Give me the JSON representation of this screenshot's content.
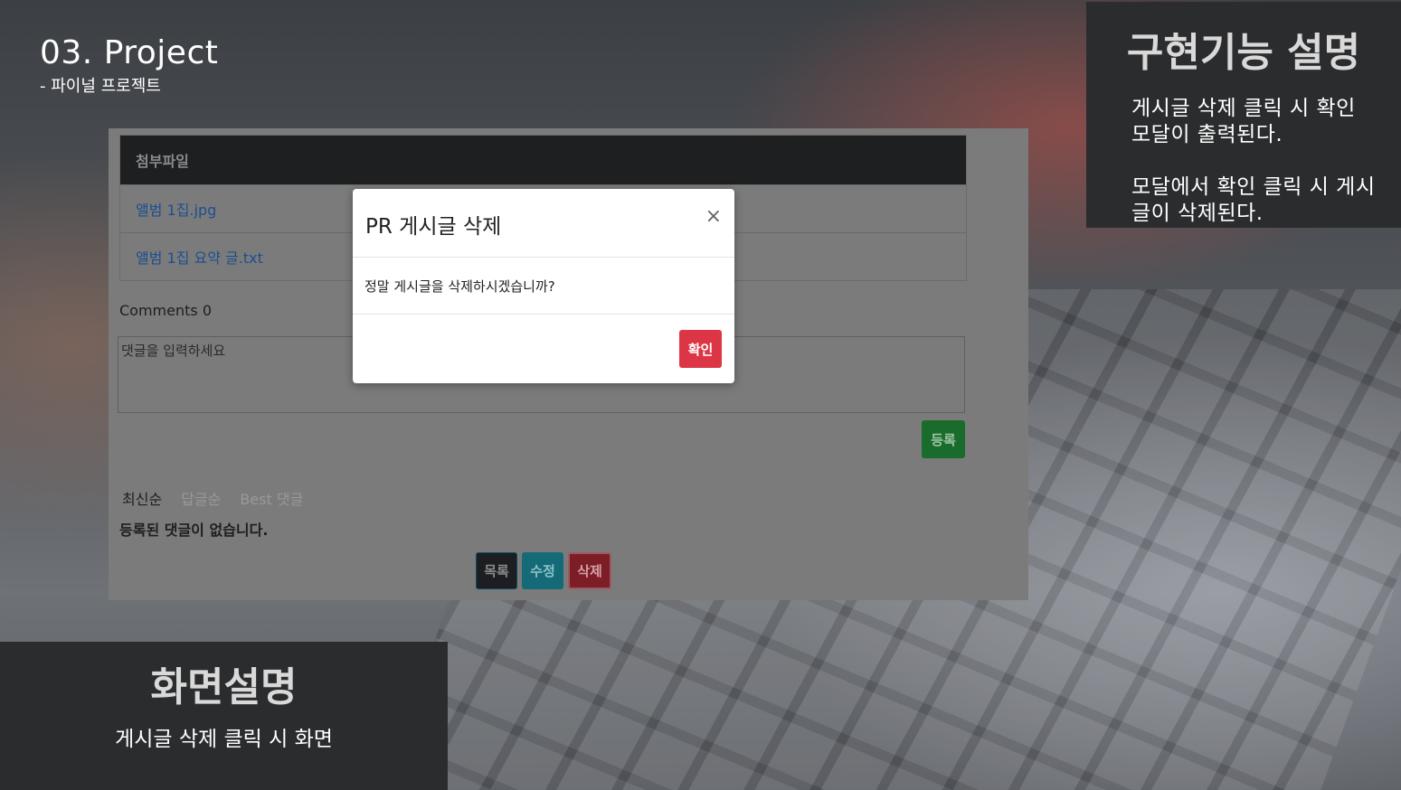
{
  "slide": {
    "title": "03.  Project",
    "subtitle": "- 파이널 프로젝트"
  },
  "feature_panel": {
    "heading": "구현기능 설명",
    "desc1": "게시글 삭제 클릭 시 확인 모달이 출력된다.",
    "desc2": "모달에서 확인 클릭 시 게시글이 삭제된다."
  },
  "screen_panel": {
    "heading": "화면설명",
    "desc": "게시글 삭제 클릭 시 화면"
  },
  "app": {
    "attachments": {
      "header": "첨부파일",
      "files": [
        "앨범 1집.jpg",
        "앨범 1집 요약 글.txt"
      ]
    },
    "comments_count": "Comments 0",
    "comment_placeholder": "댓글을 입력하세요",
    "register_label": "등록",
    "sort_tabs": [
      "최신순",
      "답글순",
      "Best 댓글"
    ],
    "no_comments": "등록된 댓글이 없습니다.",
    "buttons": {
      "list": "목록",
      "edit": "수정",
      "delete": "삭제"
    },
    "modal": {
      "title": "PR 게시글 삭제",
      "close": "×",
      "message": "정말 게시글을 삭제하시겠습니까?",
      "confirm": "확인"
    }
  }
}
